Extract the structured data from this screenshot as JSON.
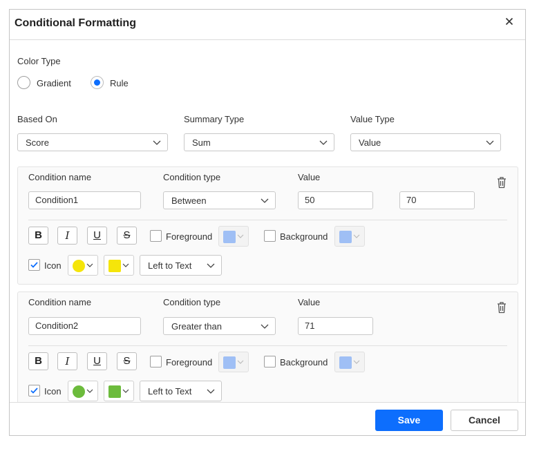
{
  "dialog": {
    "title": "Conditional Formatting",
    "close_icon": "close-icon"
  },
  "color_type": {
    "label": "Color Type",
    "options": [
      {
        "label": "Gradient",
        "selected": false
      },
      {
        "label": "Rule",
        "selected": true
      }
    ]
  },
  "fields": {
    "based_on": {
      "label": "Based On",
      "value": "Score"
    },
    "summary_type": {
      "label": "Summary Type",
      "value": "Sum"
    },
    "value_type": {
      "label": "Value Type",
      "value": "Value"
    }
  },
  "conditions": [
    {
      "name_label": "Condition name",
      "type_label": "Condition type",
      "value_label": "Value",
      "name": "Condition1",
      "type": "Between",
      "value1": "50",
      "value2": "70",
      "format_buttons": [
        "B",
        "I",
        "U",
        "S"
      ],
      "foreground_label": "Foreground",
      "foreground_checked": false,
      "background_label": "Background",
      "background_checked": false,
      "icon_label": "Icon",
      "icon_checked": true,
      "icon_color": "#f5e50a",
      "swatch_color": "#f5e50a",
      "position": "Left to Text"
    },
    {
      "name_label": "Condition name",
      "type_label": "Condition type",
      "value_label": "Value",
      "name": "Condition2",
      "type": "Greater than",
      "value1": "71",
      "format_buttons": [
        "B",
        "I",
        "U",
        "S"
      ],
      "foreground_label": "Foreground",
      "foreground_checked": false,
      "background_label": "Background",
      "background_checked": false,
      "icon_label": "Icon",
      "icon_checked": true,
      "icon_color": "#6cbb3c",
      "swatch_color": "#6cbb3c",
      "position": "Left to Text"
    }
  ],
  "colors": {
    "accent": "#0d6efd",
    "disabled_swatch": "#9fbff5"
  },
  "footer": {
    "save_label": "Save",
    "cancel_label": "Cancel"
  }
}
